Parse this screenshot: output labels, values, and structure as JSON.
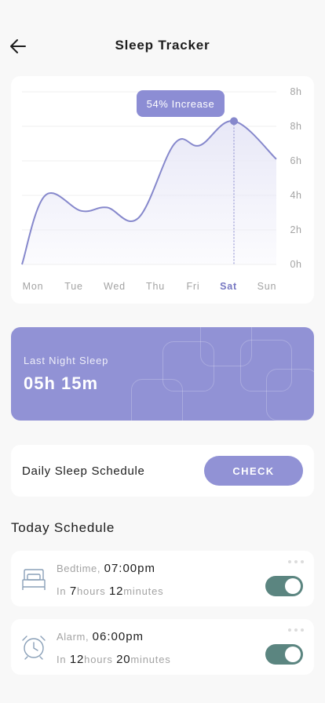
{
  "header": {
    "title": "Sleep Tracker",
    "back_icon": "arrow-left-icon"
  },
  "chart_data": {
    "type": "area",
    "categories": [
      "Mon",
      "Tue",
      "Wed",
      "Thu",
      "Fri",
      "Sat",
      "Sun"
    ],
    "values": [
      0,
      4,
      3.1,
      3.3,
      2.7,
      7,
      6.9,
      8.3,
      6.1
    ],
    "x": [
      0,
      0.55,
      1.4,
      2,
      2.75,
      3.6,
      4.2,
      5,
      6
    ],
    "y_tick_labels": [
      "8h",
      "8h",
      "6h",
      "4h",
      "2h",
      "0h"
    ],
    "ylim": [
      0,
      10
    ],
    "highlight": {
      "category": "Sat",
      "value": 8.3,
      "label": "54% Increase"
    },
    "grid": true,
    "colors": {
      "line": "#8688cc",
      "fill": "#e8e8f7",
      "active_label": "#7778c2"
    }
  },
  "last_night": {
    "label": "Last Night Sleep",
    "value": "05h 15m"
  },
  "daily_schedule": {
    "label": "Daily Sleep Schedule",
    "button": "CHECK"
  },
  "today_schedule": {
    "title": "Today Schedule",
    "items": [
      {
        "icon": "bed-icon",
        "kind": "Bedtime,",
        "time": "07:00pm",
        "in_label": "In",
        "hours": "7",
        "hours_label": "hours",
        "minutes": "12",
        "minutes_label": "minutes",
        "enabled": true
      },
      {
        "icon": "alarm-clock-icon",
        "kind": "Alarm,",
        "time": "06:00pm",
        "in_label": "In",
        "hours": "12",
        "hours_label": "hours",
        "minutes": "20",
        "minutes_label": "minutes",
        "enabled": true
      }
    ]
  },
  "colors": {
    "accent": "#9192d5",
    "toggle_on": "#5b8580",
    "background": "#f8f8f8"
  }
}
